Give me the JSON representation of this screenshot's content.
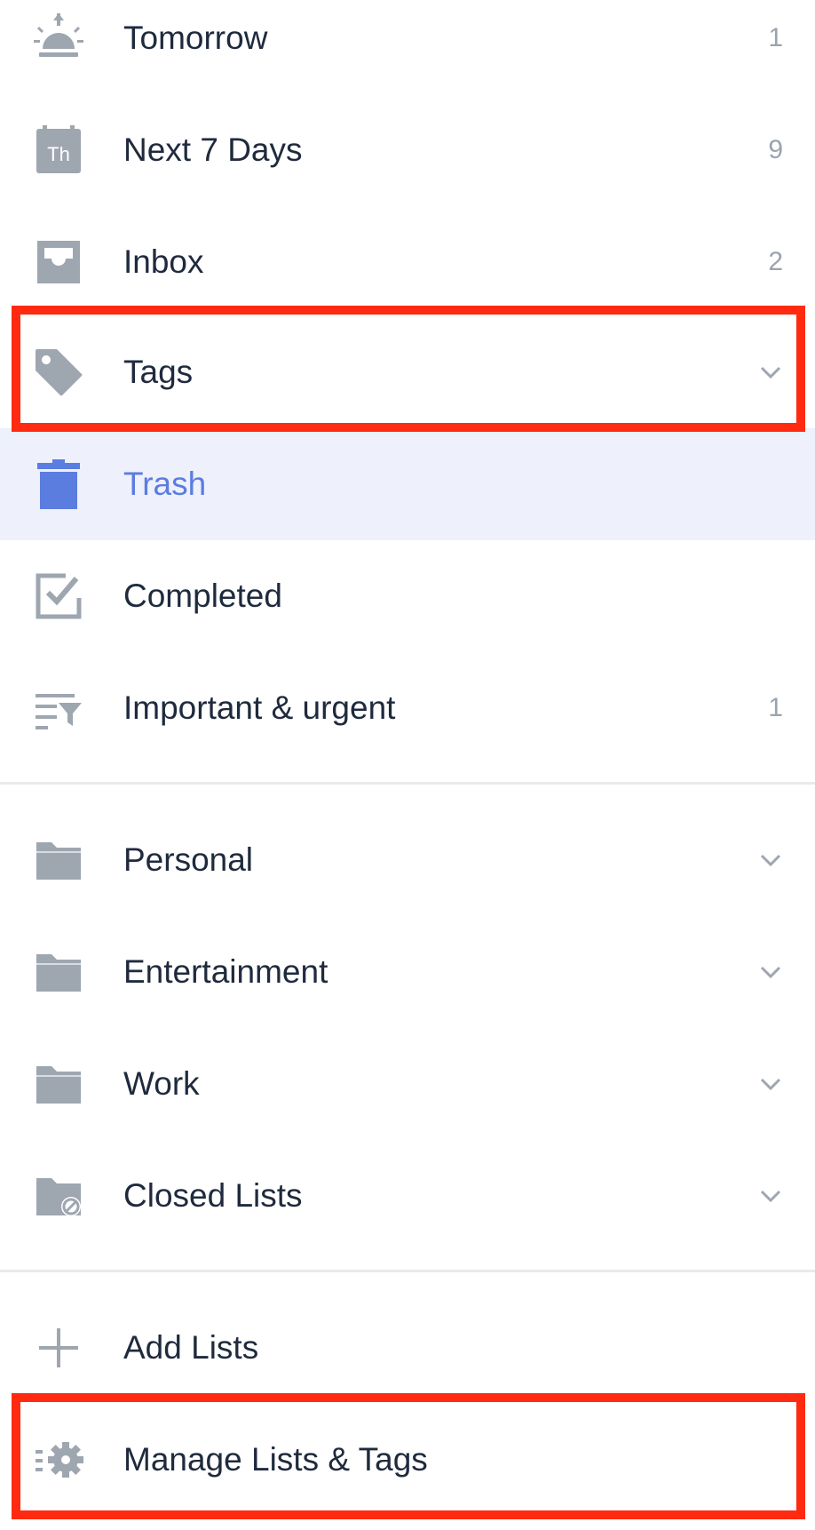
{
  "colors": {
    "text": "#1f2a3d",
    "icon": "#9ea6b0",
    "count": "#9aa3ae",
    "active_bg": "#eef0fb",
    "active_accent": "#5b7de0",
    "highlight": "#ff2a10"
  },
  "smart_lists": [
    {
      "label": "Tomorrow",
      "icon": "sunrise-icon",
      "count": "1"
    },
    {
      "label": "Next 7 Days",
      "icon": "calendar-th-icon",
      "calendar_text": "Th",
      "count": "9"
    },
    {
      "label": "Inbox",
      "icon": "inbox-icon",
      "count": "2"
    },
    {
      "label": "Tags",
      "icon": "tag-icon",
      "chevron": "chevron-down-icon"
    },
    {
      "label": "Trash",
      "icon": "trash-icon",
      "active": true
    },
    {
      "label": "Completed",
      "icon": "checkbox-icon"
    },
    {
      "label": "Important & urgent",
      "icon": "filter-icon",
      "count": "1"
    }
  ],
  "folders": [
    {
      "label": "Personal",
      "icon": "folder-icon",
      "chevron": "chevron-down-icon"
    },
    {
      "label": "Entertainment",
      "icon": "folder-icon",
      "chevron": "chevron-down-icon"
    },
    {
      "label": "Work",
      "icon": "folder-icon",
      "chevron": "chevron-down-icon"
    },
    {
      "label": "Closed Lists",
      "icon": "closed-folder-icon",
      "chevron": "chevron-down-icon"
    }
  ],
  "actions": [
    {
      "label": "Add Lists",
      "icon": "plus-icon"
    },
    {
      "label": "Manage Lists & Tags",
      "icon": "manage-gear-icon"
    }
  ]
}
